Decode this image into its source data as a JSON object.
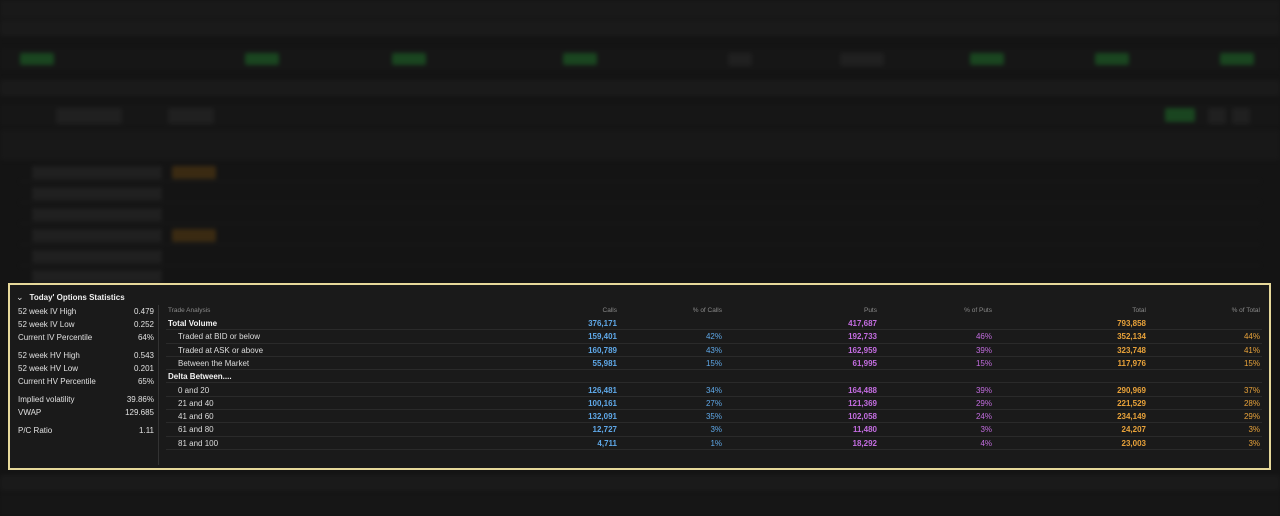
{
  "panel": {
    "title": "Today' Options Statistics",
    "left_stats": [
      {
        "label": "52 week IV High",
        "value": "0.479"
      },
      {
        "label": "52 week IV Low",
        "value": "0.252"
      },
      {
        "label": "Current IV Percentile",
        "value": "64%"
      },
      {
        "label": "52 week HV High",
        "value": "0.543"
      },
      {
        "label": "52 week HV Low",
        "value": "0.201"
      },
      {
        "label": "Current HV Percentile",
        "value": "65%"
      },
      {
        "label": "Implied volatility",
        "value": "39.86%"
      },
      {
        "label": "VWAP",
        "value": "129.685"
      },
      {
        "label": "P/C Ratio",
        "value": "1.11"
      }
    ],
    "table": {
      "headers": {
        "analysis": "Trade Analysis",
        "calls": "Calls",
        "pct_calls": "% of Calls",
        "puts": "Puts",
        "pct_puts": "% of Puts",
        "total": "Total",
        "pct_total": "% of Total"
      },
      "rows": [
        {
          "label": "Total Volume",
          "calls": "376,171",
          "pct_calls": "",
          "puts": "417,687",
          "pct_puts": "",
          "total": "793,858",
          "pct_total": ""
        },
        {
          "label": "Traded at BID or below",
          "calls": "159,401",
          "pct_calls": "42%",
          "puts": "192,733",
          "pct_puts": "46%",
          "total": "352,134",
          "pct_total": "44%"
        },
        {
          "label": "Traded at ASK or above",
          "calls": "160,789",
          "pct_calls": "43%",
          "puts": "162,959",
          "pct_puts": "39%",
          "total": "323,748",
          "pct_total": "41%"
        },
        {
          "label": "Between the Market",
          "calls": "55,981",
          "pct_calls": "15%",
          "puts": "61,995",
          "pct_puts": "15%",
          "total": "117,976",
          "pct_total": "15%"
        },
        {
          "label": "Delta Between....",
          "calls": "",
          "pct_calls": "",
          "puts": "",
          "pct_puts": "",
          "total": "",
          "pct_total": ""
        },
        {
          "label": "0 and 20",
          "calls": "126,481",
          "pct_calls": "34%",
          "puts": "164,488",
          "pct_puts": "39%",
          "total": "290,969",
          "pct_total": "37%"
        },
        {
          "label": "21 and 40",
          "calls": "100,161",
          "pct_calls": "27%",
          "puts": "121,369",
          "pct_puts": "29%",
          "total": "221,529",
          "pct_total": "28%"
        },
        {
          "label": "41 and 60",
          "calls": "132,091",
          "pct_calls": "35%",
          "puts": "102,058",
          "pct_puts": "24%",
          "total": "234,149",
          "pct_total": "29%"
        },
        {
          "label": "61 and 80",
          "calls": "12,727",
          "pct_calls": "3%",
          "puts": "11,480",
          "pct_puts": "3%",
          "total": "24,207",
          "pct_total": "3%"
        },
        {
          "label": "81 and 100",
          "calls": "4,711",
          "pct_calls": "1%",
          "puts": "18,292",
          "pct_puts": "4%",
          "total": "23,003",
          "pct_total": "3%"
        }
      ]
    }
  },
  "colors": {
    "highlight_border": "#e6d89a",
    "calls": "#5fa8e8",
    "puts": "#c36de0",
    "total": "#e8a23a"
  }
}
